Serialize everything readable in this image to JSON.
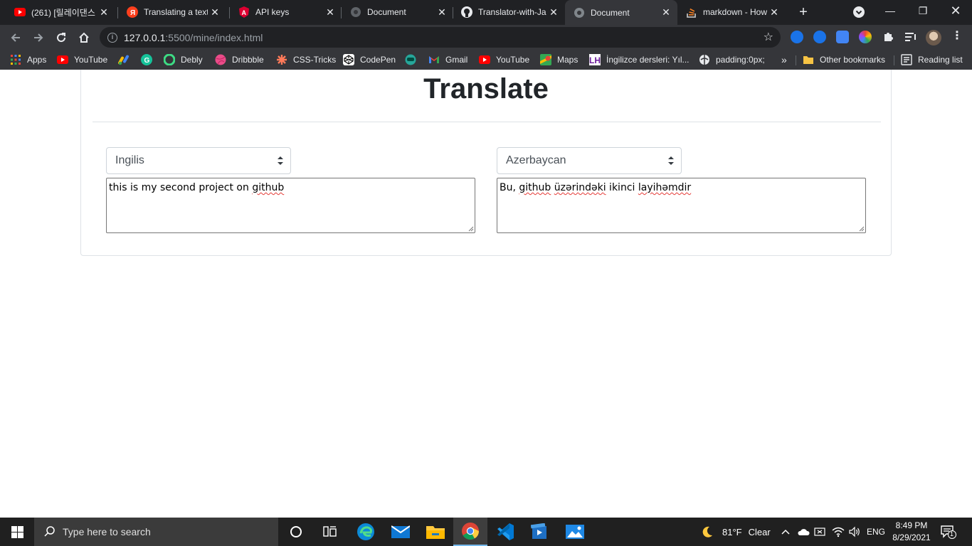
{
  "browser": {
    "tabs": [
      {
        "title": "(261) [릴레이댄스",
        "icon": "youtube-icon"
      },
      {
        "title": "Translating a text",
        "icon": "yandex-icon"
      },
      {
        "title": "API keys",
        "icon": "angular-icon"
      },
      {
        "title": "Document",
        "icon": "globe-icon"
      },
      {
        "title": "Translator-with-Ja",
        "icon": "github-icon"
      },
      {
        "title": "Document",
        "icon": "globe-icon",
        "active": true
      },
      {
        "title": "markdown - How",
        "icon": "stackoverflow-icon"
      }
    ],
    "url_host": "127.0.0.1",
    "url_path": ":5500/mine/index.html",
    "bookmarks": [
      {
        "label": "Apps",
        "icon": "apps-grid-icon"
      },
      {
        "label": "YouTube",
        "icon": "youtube-icon"
      },
      {
        "label": "",
        "icon": "google-ads-icon"
      },
      {
        "label": "",
        "icon": "grammarly-icon"
      },
      {
        "label": "Debly",
        "icon": "debly-icon"
      },
      {
        "label": "Dribbble",
        "icon": "dribbble-icon"
      },
      {
        "label": "CSS-Tricks",
        "icon": "css-tricks-icon"
      },
      {
        "label": "CodePen",
        "icon": "codepen-icon"
      },
      {
        "label": "",
        "icon": "bookmark-icon"
      },
      {
        "label": "Gmail",
        "icon": "gmail-icon"
      },
      {
        "label": "YouTube",
        "icon": "youtube-icon"
      },
      {
        "label": "Maps",
        "icon": "maps-icon"
      },
      {
        "label": "İngilizce dersleri: Yıl...",
        "icon": "lh-icon"
      },
      {
        "label": "padding:0px;",
        "icon": "globe-icon"
      }
    ],
    "overflow_label": "»",
    "other_bookmarks": "Other bookmarks",
    "reading_list": "Reading list"
  },
  "app": {
    "title": "Translate",
    "source_language": "Ingilis",
    "target_language": "Azerbaycan",
    "source_text": "this is my second project on github",
    "target_text": "Bu, github üzərindəki ikinci layihəmdir",
    "source_text_parts": {
      "before": "this is my second project on ",
      "misspelled": "github"
    },
    "target_text_parts": {
      "t1": "Bu, ",
      "m1": "github",
      "t2": " ",
      "m2": "üzərindəki",
      "t3": " ikinci ",
      "m3": "layihəmdir"
    }
  },
  "taskbar": {
    "search_placeholder": "Type here to search",
    "weather_temp": "81°F",
    "weather_text": "Clear",
    "language": "ENG",
    "time": "8:49 PM",
    "date": "8/29/2021",
    "notification_count": "1"
  },
  "colors": {
    "chrome_dark": "#202124",
    "chrome_toolbar": "#35363a",
    "taskbar": "#202020",
    "text_dark": "#212529",
    "border_light": "#dee2e6"
  }
}
